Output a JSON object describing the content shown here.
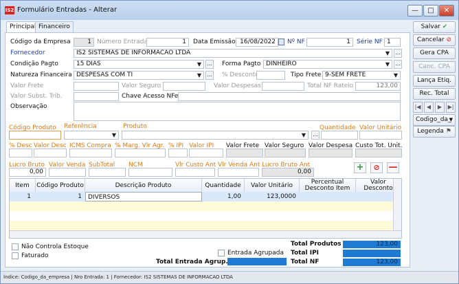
{
  "window": {
    "title": "Formulário Entradas - Alterar",
    "logo": "IS2"
  },
  "tabs": [
    "Principal",
    "Financeiro"
  ],
  "header": {
    "codigo_empresa_label": "Código da Empresa",
    "codigo_empresa_value": "1",
    "numero_entrada_label": "Número Entrada",
    "numero_entrada_value": "1",
    "data_emissao_label": "Data Emissão",
    "data_emissao_value": "16/08/2022",
    "nro_nf_label": "Nº NF",
    "nro_nf_value": "1",
    "serie_nf_label": "Série NF",
    "serie_nf_value": "1",
    "fornecedor_label": "Fornecedor",
    "fornecedor_value": "IS2 SISTEMAS DE INFORMACAO LTDA",
    "condicao_pagto_label": "Condição Pagto",
    "condicao_pagto_value": "15 DIAS",
    "forma_pagto_label": "Forma Pagto",
    "forma_pagto_value": "DINHEIRO",
    "natureza_label": "Natureza Financeira",
    "natureza_value": "DESPESAS COM TI",
    "desconto_pct_label": "% Desconto",
    "tipo_frete_label": "Tipo Frete",
    "tipo_frete_value": "9-SEM FRETE",
    "valor_frete_label": "Valor Frete",
    "valor_seguro_label": "Valor Seguro",
    "valor_despesas_label": "Valor Despesas",
    "total_nf_rateio_label": "Total NF Rateio",
    "total_nf_rateio_value": "123,00",
    "valor_subst_label": "Valor Subst. Trib.",
    "chave_acesso_label": "Chave Acesso NFe",
    "observacao_label": "Observação"
  },
  "item_entry": {
    "codigo_produto": "Código Produto",
    "referencia": "Referência",
    "produto": "Produto",
    "quantidade": "Quantidade",
    "valor_unitario": "Valor Unitário",
    "pct_desc": "% Desc",
    "valor_desc": "Valor Desc",
    "icms_compra": "ICMS Compra",
    "pct_marg": "% Marg. Vlr Agr.",
    "pct_ipi": "% IPI",
    "valor_ipi": "Valor IPI",
    "valor_frete": "Valor Frete",
    "valor_seguro": "Valor Seguro",
    "valor_despesa": "Valor Despesa",
    "custo_tot_unit": "Custo Tot. Unit.",
    "lucro_bruto": "Lucro Bruto",
    "lucro_bruto_value": "0,00",
    "valor_venda": "Valor Venda",
    "subtotal": "SubTotal",
    "ncm": "NCM",
    "vlr_custo_ant": "Vlr Custo Ant",
    "vlr_venda_ant": "Vlr Venda Ant",
    "lucro_bruto_ant": "Lucro Bruto Ant",
    "lucro_bruto_ant_value": "0,00"
  },
  "grid": {
    "columns": [
      "Item",
      "Código Produto",
      "Descrição Produto",
      "Quantidade",
      "Valor Unitário",
      "Percentual Desconto Item",
      "Valor Desconto"
    ],
    "rows": [
      {
        "item": "1",
        "codigo": "1",
        "descricao": "DIVERSOS",
        "quantidade": "1,00",
        "valor_unitario": "123,0000",
        "percentual": "",
        "valor_desconto": ""
      }
    ]
  },
  "footer": {
    "nao_controla_estoque": "Não Controla Estoque",
    "faturado": "Faturado",
    "entrada_agrupada": "Entrada Agrupada",
    "total_entrada_agrup": "Total Entrada Agrup.",
    "total_produtos_label": "Total Produtos",
    "total_produtos_value": "123,00",
    "total_ipi_label": "Total IPI",
    "total_ipi_value": "",
    "total_nf_label": "Total NF",
    "total_nf_value": "123,00"
  },
  "side": {
    "salvar": "Salvar",
    "cancelar": "Cancelar",
    "gera_cpa": "Gera CPA",
    "canc_cpa": "Canc. CPA",
    "lanca_etiq": "Lança Etiq.",
    "rec_total": "Rec. Total",
    "order_select": "Codigo_da_",
    "legenda": "Legenda"
  },
  "status_bar": "Índice: Codigo_da_empresa | Nro Entrada: 1 | Fornecedor: IS2 SISTEMAS DE INFORMACAO LTDA",
  "colors": {
    "accent": "#1e7ad2",
    "label_orange": "#e07a17",
    "label_blue": "#1c3fa8"
  }
}
